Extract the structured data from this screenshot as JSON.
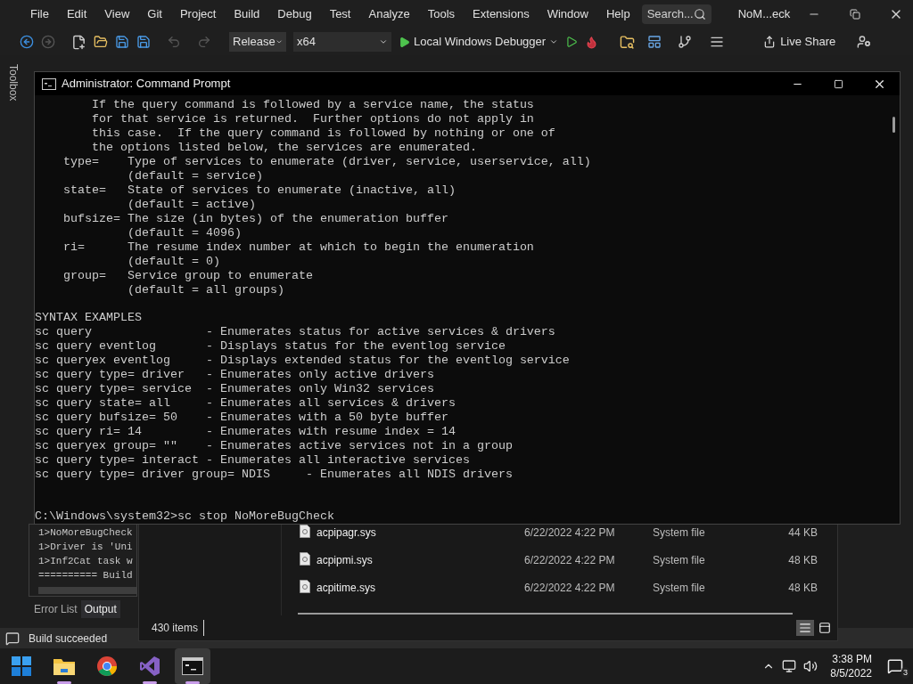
{
  "menu": [
    "File",
    "Edit",
    "View",
    "Git",
    "Project",
    "Build",
    "Debug",
    "Test",
    "Analyze",
    "Tools",
    "Extensions",
    "Window",
    "Help"
  ],
  "search": {
    "placeholder": "Search..."
  },
  "solution_name": "NoM...eck",
  "toolbar": {
    "configuration": "Release",
    "platform": "x64",
    "debugger": "Local Windows Debugger",
    "live_share": "Live Share"
  },
  "toolbox_tab": "Toolbox",
  "output_panel": {
    "lines": [
      "1>NoMoreBugCheck",
      "1>Driver is 'Uni",
      "1>Inf2Cat task w",
      "========== Build"
    ],
    "tabs": [
      {
        "label": "Error List",
        "selected": false
      },
      {
        "label": "Output",
        "selected": true
      }
    ]
  },
  "status_bar": {
    "message": "Build succeeded"
  },
  "explorer": {
    "files": [
      {
        "name": "acpipagr.sys",
        "modified": "6/22/2022 4:22 PM",
        "type": "System file",
        "size": "44 KB"
      },
      {
        "name": "acpipmi.sys",
        "modified": "6/22/2022 4:22 PM",
        "type": "System file",
        "size": "48 KB"
      },
      {
        "name": "acpitime.sys",
        "modified": "6/22/2022 4:22 PM",
        "type": "System file",
        "size": "48 KB"
      }
    ],
    "item_count": "430 items",
    "views": [
      {
        "kind": "details",
        "selected": true
      },
      {
        "kind": "preview",
        "selected": false
      }
    ]
  },
  "console": {
    "title": "Administrator: Command Prompt",
    "lines": [
      {
        "kind": "text",
        "text": "        If the query command is followed by a service name, the status"
      },
      {
        "kind": "text",
        "text": "        for that service is returned.  Further options do not apply in"
      },
      {
        "kind": "text",
        "text": "        this case.  If the query command is followed by nothing or one of"
      },
      {
        "kind": "text",
        "text": "        the options listed below, the services are enumerated."
      },
      {
        "kind": "text",
        "text": "    type=    Type of services to enumerate (driver, service, userservice, all)"
      },
      {
        "kind": "text",
        "text": "             (default = service)"
      },
      {
        "kind": "text",
        "text": "    state=   State of services to enumerate (inactive, all)"
      },
      {
        "kind": "text",
        "text": "             (default = active)"
      },
      {
        "kind": "text",
        "text": "    bufsize= The size (in bytes) of the enumeration buffer"
      },
      {
        "kind": "text",
        "text": "             (default = 4096)"
      },
      {
        "kind": "text",
        "text": "    ri=      The resume index number at which to begin the enumeration"
      },
      {
        "kind": "text",
        "text": "             (default = 0)"
      },
      {
        "kind": "text",
        "text": "    group=   Service group to enumerate"
      },
      {
        "kind": "text",
        "text": "             (default = all groups)"
      },
      {
        "kind": "blank"
      },
      {
        "kind": "text",
        "text": "SYNTAX EXAMPLES"
      },
      {
        "kind": "text",
        "text": "sc query                - Enumerates status for active services & drivers"
      },
      {
        "kind": "text",
        "text": "sc query eventlog       - Displays status for the eventlog service"
      },
      {
        "kind": "text",
        "text": "sc queryex eventlog     - Displays extended status for the eventlog service"
      },
      {
        "kind": "text",
        "text": "sc query type= driver   - Enumerates only active drivers"
      },
      {
        "kind": "text",
        "text": "sc query type= service  - Enumerates only Win32 services"
      },
      {
        "kind": "text",
        "text": "sc query state= all     - Enumerates all services & drivers"
      },
      {
        "kind": "text",
        "text": "sc query bufsize= 50    - Enumerates with a 50 byte buffer"
      },
      {
        "kind": "text",
        "text": "sc query ri= 14         - Enumerates with resume index = 14"
      },
      {
        "kind": "text",
        "text": "sc queryex group= \"\"    - Enumerates active services not in a group"
      },
      {
        "kind": "text",
        "text": "sc query type= interact - Enumerates all interactive services"
      },
      {
        "kind": "text",
        "text": "sc query type= driver group= NDIS     - Enumerates all NDIS drivers"
      },
      {
        "kind": "blank"
      },
      {
        "kind": "blank"
      },
      {
        "kind": "text",
        "text": "C:\\Windows\\system32>sc stop NoMoreBugCheck"
      }
    ]
  },
  "taskbar": {
    "apps": [
      {
        "kind": "start",
        "running": false,
        "selected": false
      },
      {
        "kind": "files",
        "running": true,
        "selected": false
      },
      {
        "kind": "browser",
        "running": false,
        "selected": false
      },
      {
        "kind": "ide",
        "running": true,
        "selected": false
      },
      {
        "kind": "terminal",
        "running": true,
        "selected": true
      }
    ],
    "time": "3:38 PM",
    "date": "8/5/2022",
    "notifications": "3"
  }
}
